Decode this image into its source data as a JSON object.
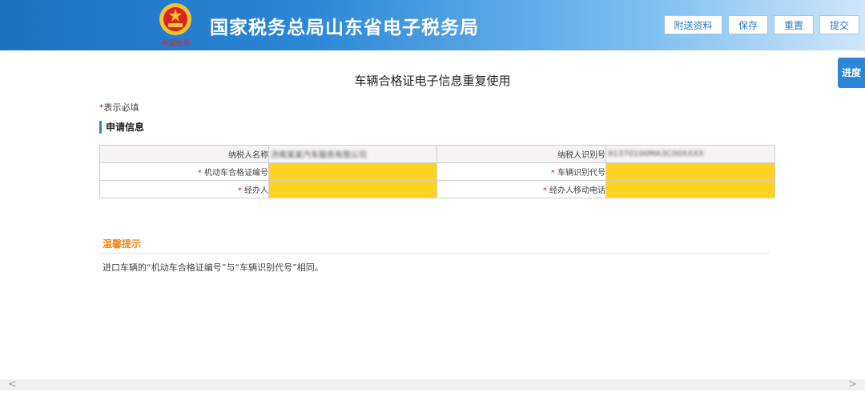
{
  "header": {
    "title": "国家税务总局山东省电子税务局",
    "buttons": [
      {
        "label": "附送资料"
      },
      {
        "label": "保存"
      },
      {
        "label": "重置"
      },
      {
        "label": "提交"
      }
    ]
  },
  "side_tab": {
    "label": "进度"
  },
  "page": {
    "title": "车辆合格证电子信息重复使用",
    "required_star": "*",
    "required_note": "表示必填"
  },
  "section": {
    "title": "申请信息"
  },
  "form": {
    "rows": [
      {
        "label1": "纳税人名称",
        "value1": "济南某某汽车服务有限公司",
        "label2": "纳税人识别号",
        "value2": "91370100MA3C00XXXX"
      },
      {
        "label1": "机动车合格证编号",
        "value1": "",
        "label2": "车辆识别代号",
        "value2": ""
      },
      {
        "label1": "经办人",
        "value1": "",
        "label2": "经办人移动电话",
        "value2": ""
      }
    ]
  },
  "tips": {
    "title": "温馨提示",
    "text": "进口车辆的“机动车合格证编号”与“车辆识别代号”相同。"
  },
  "scrollbar": {
    "left_arrow": "<",
    "right_arrow": ">"
  },
  "colors": {
    "accent": "#2b88d8",
    "required_field": "#ffd21f",
    "tip_title": "#f28a1b",
    "required_star": "#e21f1f"
  }
}
